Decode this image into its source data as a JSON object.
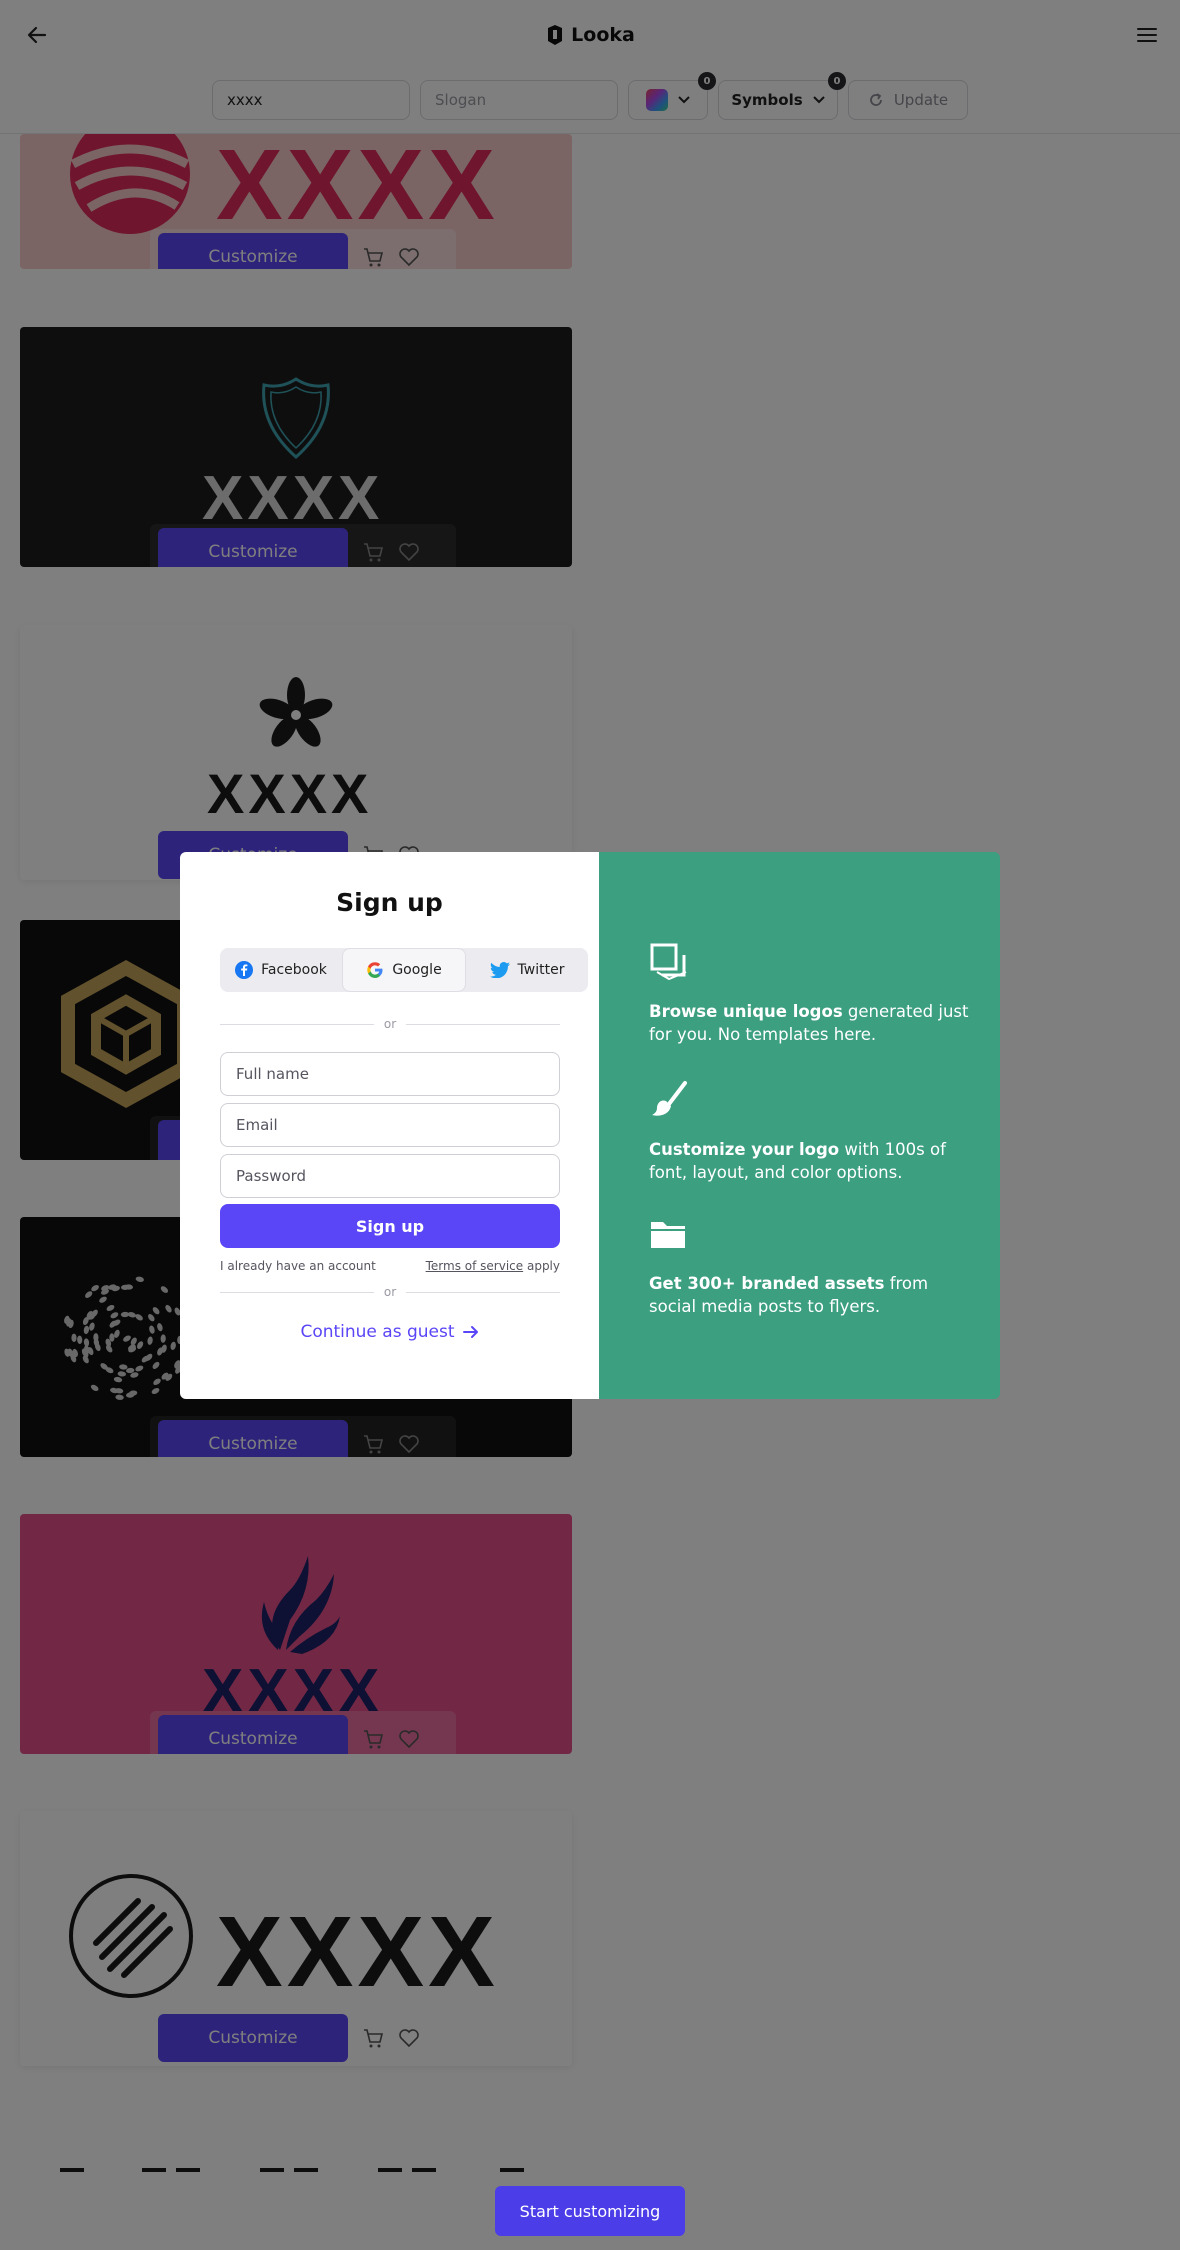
{
  "header": {
    "brand_name": "Looka",
    "back_icon": "arrow-left-icon",
    "menu_icon": "hamburger-menu-icon"
  },
  "filters": {
    "company_name_value": "xxxx",
    "slogan_placeholder": "Slogan",
    "colors_count": "0",
    "symbols_label": "Symbols",
    "symbols_count": "0",
    "update_label": "Update"
  },
  "logo_cards": [
    {
      "wordmark": "XXXX",
      "background": "#f6c9c8",
      "wordmark_color": "#df2a5a",
      "symbol": "striped-sphere"
    },
    {
      "wordmark": "XXXX",
      "background": "#1c1c1c",
      "wordmark_color": "#d8d8d8",
      "symbol": "shield-outline"
    },
    {
      "wordmark": "XXXX",
      "background": "#ffffff",
      "wordmark_color": "#1a1a1a",
      "symbol": "pinwheel-flower"
    },
    {
      "wordmark": "",
      "background": "#111111",
      "wordmark_color": "#c5a25a",
      "symbol": "hexagon-cube"
    },
    {
      "wordmark": "",
      "background": "#111111",
      "wordmark_color": "#ffffff",
      "symbol": "dot-burst"
    },
    {
      "wordmark": "XXXX",
      "background": "#e54f8a",
      "wordmark_color": "#1d2366",
      "symbol": "feather-wing"
    },
    {
      "wordmark": "XXXX",
      "background": "#ffffff",
      "wordmark_color": "#1a1a1a",
      "symbol": "hatched-circle"
    }
  ],
  "card_actions": {
    "customize_label": "Customize",
    "cart_icon": "cart-icon",
    "favorite_icon": "heart-icon"
  },
  "bottom_cta": {
    "label": "Start customizing"
  },
  "signup_modal": {
    "title": "Sign up",
    "social": {
      "facebook_label": "Facebook",
      "google_label": "Google",
      "twitter_label": "Twitter"
    },
    "divider_text": "or",
    "full_name_placeholder": "Full name",
    "email_placeholder": "Email",
    "password_placeholder": "Password",
    "submit_label": "Sign up",
    "have_account_text": "I already have an account",
    "terms_link": "Terms of service",
    "terms_suffix": "apply",
    "guest_label": "Continue as guest",
    "features": [
      {
        "icon": "logos-stack-icon",
        "bold": "Browse unique logos",
        "text": " generated just for you. No templates here."
      },
      {
        "icon": "paintbrush-icon",
        "bold": "Customize your logo",
        "text": " with 100s of font, layout, and color options."
      },
      {
        "icon": "folder-icon",
        "bold": "Get 300+ branded assets",
        "text": " from social media posts to flyers."
      }
    ],
    "colors": {
      "panel": "#3b9f80",
      "primary": "#5a46f6"
    }
  }
}
